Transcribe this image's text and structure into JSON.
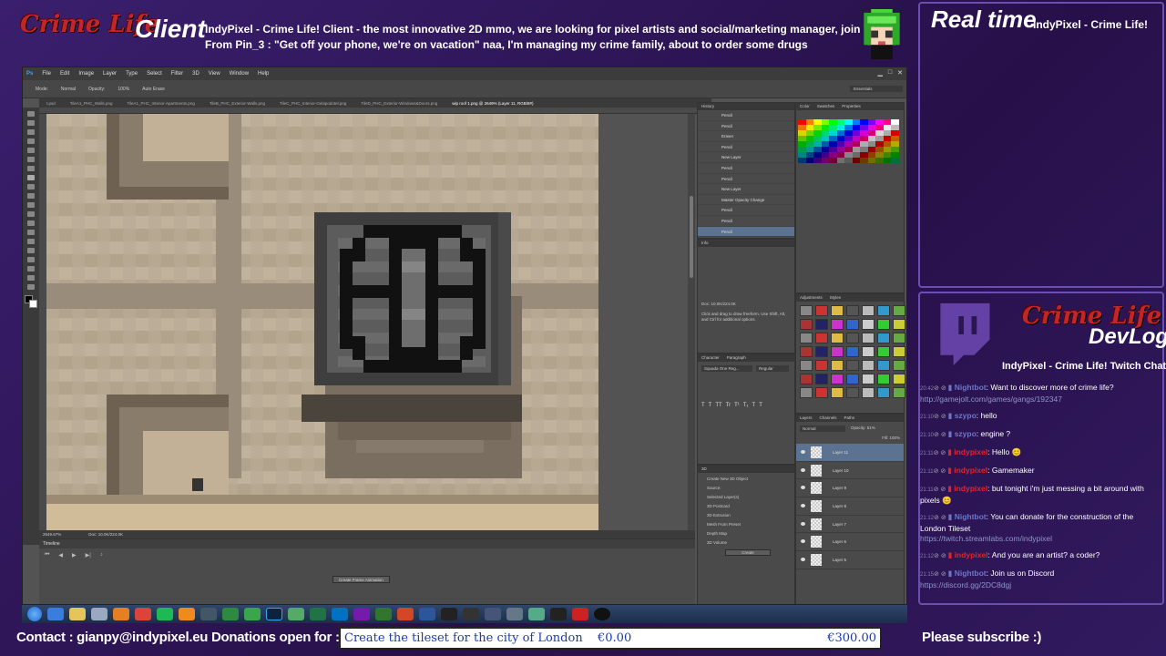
{
  "overlay": {
    "logo_text": "Crime Life",
    "client_label": "Client",
    "ticker_line1": "IndyPixel - Crime Life!  Client - the most innovative 2D mmo, we are looking for pixel artists and social/marketing manager, join us!",
    "ticker_line2": "From Pin_3 :  \"Get off your phone, we're on vacation\" naa, I'm managing my crime family, about to order some drugs",
    "realtime_label": "Real time",
    "realtime_sub": "IndyPixel - Crime Life!",
    "devlog_label": "DevLog",
    "devlog_logo": "Crime Life",
    "chat_title": "IndyPixel - Crime Life!  Twitch Chat",
    "contact": "Contact : gianpy@indypixel.eu  Donations open for :",
    "donation_goal": "Create the tileset for the city of London",
    "donation_current": "€0.00",
    "donation_target": "€300.00",
    "subscribe": "Please subscribe :)"
  },
  "colors": {
    "accent_purple": "#3a1f6e",
    "logo_red": "#c0262a",
    "mod_red": "#e0262a",
    "nightbot_blue": "#6d76c9",
    "user_blue": "#6d76c9",
    "link": "#8e95c8"
  },
  "photoshop": {
    "menu": [
      "Ps",
      "File",
      "Edit",
      "Image",
      "Layer",
      "Type",
      "Select",
      "Filter",
      "3D",
      "View",
      "Window",
      "Help"
    ],
    "options": [
      "Mode:",
      "Normal",
      "Opacity:",
      "100%",
      "Auto Erase"
    ],
    "workspace": "Essentials",
    "tabs": [
      "t.psd",
      "TileA1_PHC_Walls.png",
      "TileA1_PHC_Interior-Apartments.png",
      "TileB_PHC_Exterior-Walls.png",
      "TileC_PHC_Interior-Gelapodotel.png",
      "TileD_PHC_Exterior-Windows&Doors.png",
      "wip roof 1.png @ 2649% (Layer 11, RGB/8#)"
    ],
    "status_zoom": "2649.67%",
    "status_doc": "Doc: 10.0K/224.0K",
    "timeline_title": "Timeline",
    "timeline_button": "Create Frame Animation",
    "history_title": "History",
    "history": [
      "Pencil",
      "Pencil",
      "Eraser",
      "Pencil",
      "New Layer",
      "Pencil",
      "Pencil",
      "New Layer",
      "Master Opacity Change",
      "Pencil",
      "Pencil",
      "Pencil"
    ],
    "info_title": "Info",
    "info_doc": "Doc: 10.0K/224.0K",
    "info_hint": "Click and drag to draw freeform. Use Shift, Alt, and Ctrl for additional options.",
    "swatches_tabs": [
      "Color",
      "Swatches",
      "Properties"
    ],
    "adjustments_tabs": [
      "Adjustments",
      "Styles"
    ],
    "character_tabs": [
      "Character",
      "Paragraph"
    ],
    "character_font": "Squada One Reg...",
    "character_style": "Regular",
    "threed_title": "3D",
    "threed_items": [
      "Create New 3D Object",
      "Source:",
      "Selected Layer(s)",
      "3D Postcard",
      "3D Extrusion",
      "Mesh From Preset",
      "Depth Map",
      "3D Volume",
      "Create"
    ],
    "layers_tabs": [
      "Layers",
      "Channels",
      "Paths"
    ],
    "layers_blend": "Normal",
    "layers_opacity": "Opacity: 51%",
    "layers_fill": "Fill: 100%",
    "layers": [
      "Layer 11",
      "Layer 10",
      "Layer 9",
      "Layer 8",
      "Layer 7",
      "Layer 6",
      "Layer 5"
    ]
  },
  "chat": [
    {
      "time": "20:42",
      "user": "Nightbot",
      "user_color": "#6d76c9",
      "text": "Want to discover more of crime life?",
      "link": "http://gamejolt.com/games/gangs/192347"
    },
    {
      "time": "21:10",
      "user": "szypo",
      "user_color": "#6d76c9",
      "text": "hello",
      "link": ""
    },
    {
      "time": "21:10",
      "user": "szypo",
      "user_color": "#6d76c9",
      "text": "engine ?",
      "link": ""
    },
    {
      "time": "21:11",
      "user": "indypixel",
      "user_color": "#e0262a",
      "text": "Hello 😊",
      "link": ""
    },
    {
      "time": "21:11",
      "user": "indypixel",
      "user_color": "#e0262a",
      "text": "Gamemaker",
      "link": ""
    },
    {
      "time": "21:11",
      "user": "indypixel",
      "user_color": "#e0262a",
      "text": "but tonight i'm just messing a bit around with pixels 😊",
      "link": ""
    },
    {
      "time": "21:12",
      "user": "Nightbot",
      "user_color": "#6d76c9",
      "text": "You can donate for the construction of the London Tileset",
      "link": "https://twitch.streamlabs.com/indypixel"
    },
    {
      "time": "21:12",
      "user": "indypixel",
      "user_color": "#e0262a",
      "text": "And you are an artist? a coder?",
      "link": ""
    },
    {
      "time": "21:15",
      "user": "Nightbot",
      "user_color": "#6d76c9",
      "text": "Join us on Discord",
      "link": "https://discord.gg/2DC8dgj"
    }
  ]
}
